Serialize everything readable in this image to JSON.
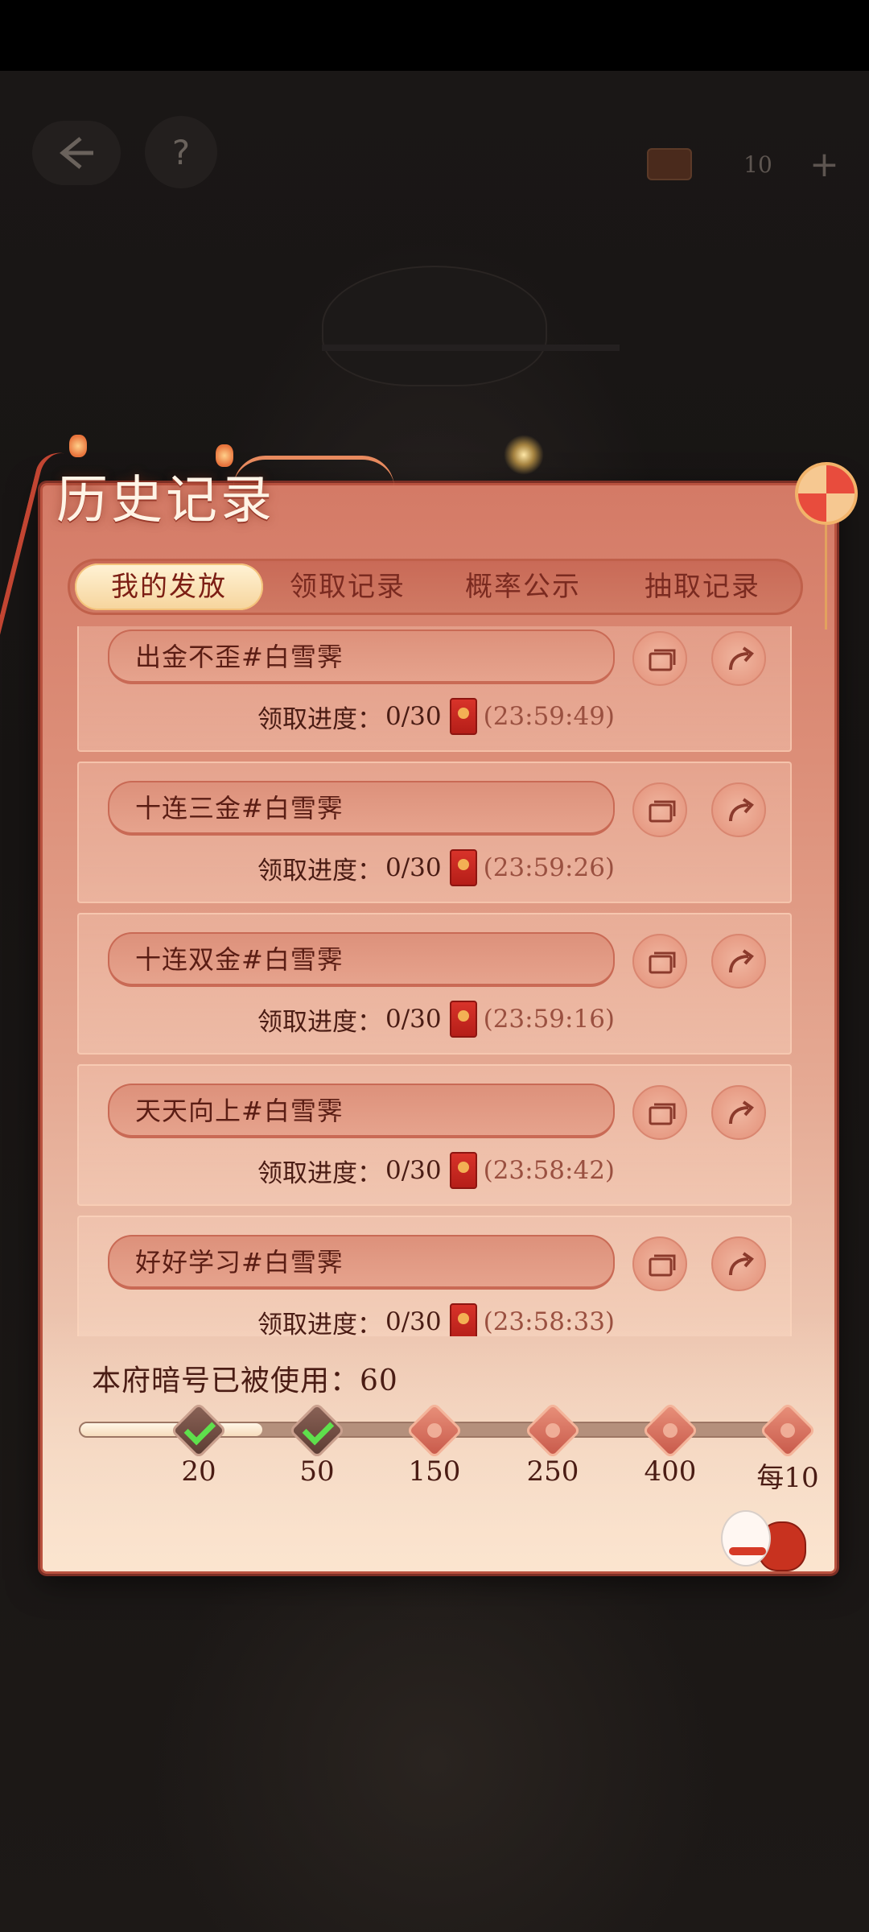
{
  "top_bar": {
    "back_icon": "back-arrow-icon",
    "help_label": "?",
    "currency": {
      "icon": "cake-icon",
      "value": "10",
      "plus_label": "+"
    }
  },
  "panel": {
    "title": "历史记录",
    "tabs": [
      {
        "label": "我的发放",
        "active": true
      },
      {
        "label": "领取记录",
        "active": false
      },
      {
        "label": "概率公示",
        "active": false
      },
      {
        "label": "抽取记录",
        "active": false
      }
    ],
    "records": [
      {
        "name": "出金不歪#白雪霁",
        "progress_label": "领取进度：",
        "progress": "0/30",
        "time": "(23:59:49)"
      },
      {
        "name": "十连三金#白雪霁",
        "progress_label": "领取进度：",
        "progress": "0/30",
        "time": "(23:59:26)"
      },
      {
        "name": "十连双金#白雪霁",
        "progress_label": "领取进度：",
        "progress": "0/30",
        "time": "(23:59:16)"
      },
      {
        "name": "天天向上#白雪霁",
        "progress_label": "领取进度：",
        "progress": "0/30",
        "time": "(23:58:42)"
      },
      {
        "name": "好好学习#白雪霁",
        "progress_label": "领取进度：",
        "progress": "0/30",
        "time": "(23:58:33)"
      }
    ],
    "usage": {
      "label": "本府暗号已被使用：60",
      "used_count": 60,
      "milestones": [
        {
          "label": "20",
          "claimed": true
        },
        {
          "label": "50",
          "claimed": true
        },
        {
          "label": "150",
          "claimed": false
        },
        {
          "label": "250",
          "claimed": false
        },
        {
          "label": "400",
          "claimed": false
        },
        {
          "label": "每10",
          "claimed": false
        }
      ]
    }
  },
  "colors": {
    "panel_top": "#d47a66",
    "panel_bottom": "#f3dcc8",
    "accent_red": "#c24532",
    "text_dark": "#4a1c14",
    "check_green": "#5ee04c"
  }
}
